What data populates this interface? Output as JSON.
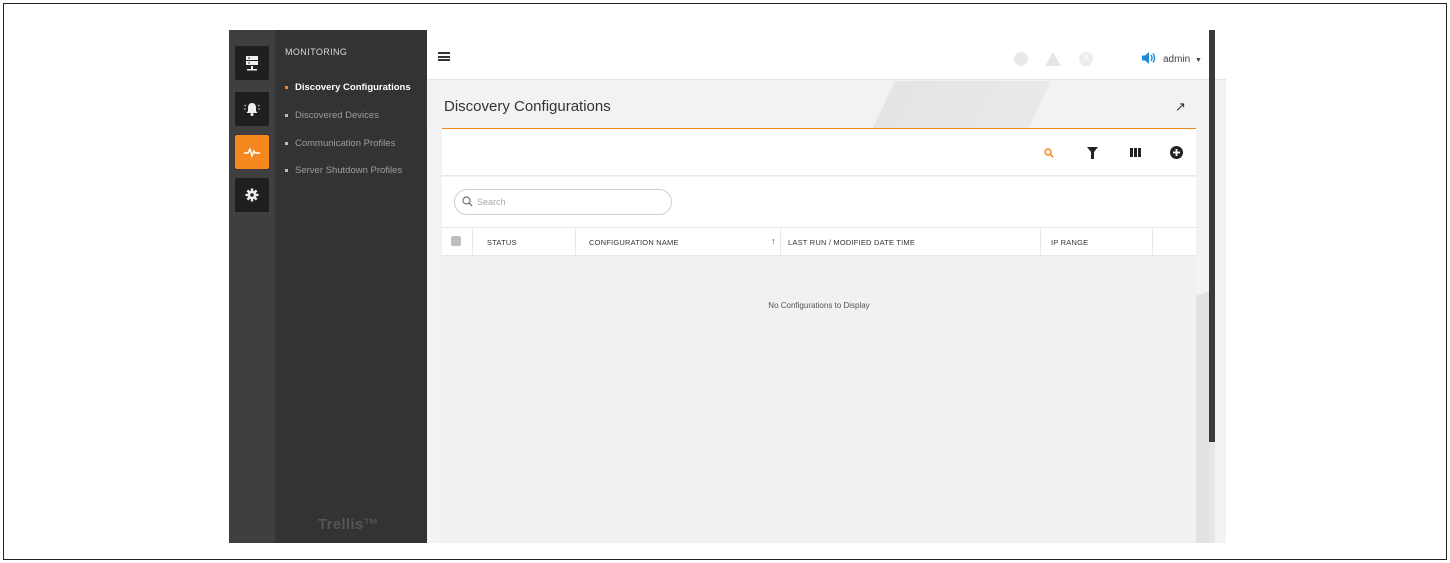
{
  "nav": {
    "section_title": "MONITORING",
    "items": [
      {
        "label": "Discovery Configurations",
        "active": true
      },
      {
        "label": "Discovered Devices",
        "active": false
      },
      {
        "label": "Communication Profiles",
        "active": false
      },
      {
        "label": "Server Shutdown Profiles",
        "active": false
      }
    ],
    "brand": "Trellis™"
  },
  "rail": {
    "icons": [
      "server-icon",
      "alarm-bell-icon",
      "pulse-icon",
      "gear-icon"
    ],
    "active_icon": "pulse-icon"
  },
  "topbar": {
    "user": "admin",
    "status_icons": [
      "info-status-icon",
      "warning-status-icon",
      "error-status-icon",
      "speaker-icon"
    ]
  },
  "page": {
    "title": "Discovery Configurations"
  },
  "search": {
    "placeholder": "Search"
  },
  "table": {
    "columns": [
      "STATUS",
      "CONFIGURATION NAME",
      "LAST RUN / MODIFIED DATE TIME",
      "IP RANGE"
    ],
    "sort_indicator": "↑",
    "empty_message": "No Configurations to Display"
  },
  "colors": {
    "accent": "#f5871f",
    "speaker": "#1a8fd6",
    "sidebar": "#333333",
    "rail": "#3f3f3f"
  }
}
